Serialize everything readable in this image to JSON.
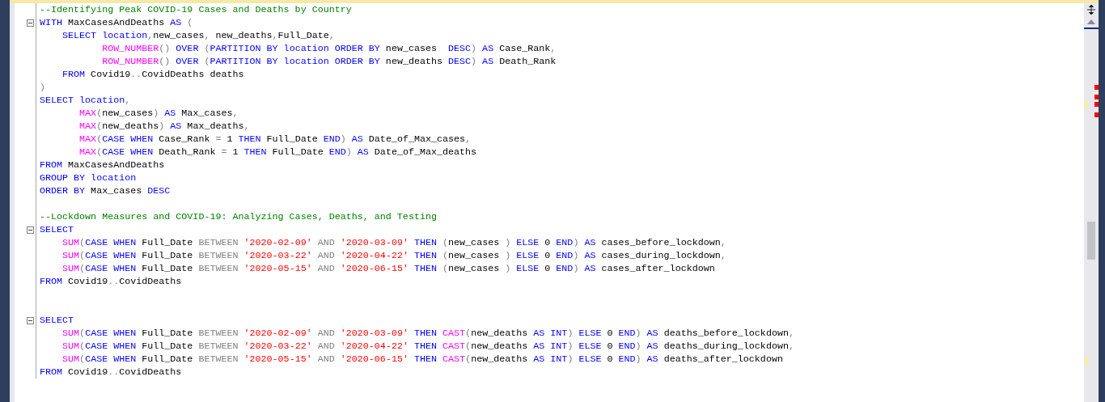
{
  "editor": {
    "lines": [
      {
        "kind": "code",
        "fold": false,
        "tokens": [
          {
            "text": "--Identifying Peak COVID-19 Cases and Deaths by Country",
            "kind": "comment"
          }
        ]
      },
      {
        "kind": "code",
        "fold": true,
        "tokens": [
          {
            "text": "WITH",
            "kind": "keyword"
          },
          {
            "text": " MaxCasesAndDeaths ",
            "kind": "plain"
          },
          {
            "text": "AS",
            "kind": "keyword"
          },
          {
            "text": " (",
            "kind": "punct"
          }
        ]
      },
      {
        "kind": "code",
        "fold": false,
        "tokens": [
          {
            "text": "    SELECT location",
            "kind": "keyword"
          },
          {
            "text": ",",
            "kind": "punct"
          },
          {
            "text": "new_cases",
            "kind": "plain"
          },
          {
            "text": ",",
            "kind": "punct"
          },
          {
            "text": " new_deaths",
            "kind": "plain"
          },
          {
            "text": ",",
            "kind": "punct"
          },
          {
            "text": "Full_Date",
            "kind": "plain"
          },
          {
            "text": ",",
            "kind": "punct"
          }
        ]
      },
      {
        "kind": "code",
        "fold": false,
        "tokens": [
          {
            "text": "           ROW_NUMBER",
            "kind": "function"
          },
          {
            "text": "()",
            "kind": "punct"
          },
          {
            "text": " OVER ",
            "kind": "keyword"
          },
          {
            "text": "(",
            "kind": "punct"
          },
          {
            "text": "PARTITION BY location ORDER BY",
            "kind": "keyword"
          },
          {
            "text": " new_cases  ",
            "kind": "plain"
          },
          {
            "text": "DESC",
            "kind": "keyword"
          },
          {
            "text": ")",
            "kind": "punct"
          },
          {
            "text": " AS",
            "kind": "keyword"
          },
          {
            "text": " Case_Rank",
            "kind": "plain"
          },
          {
            "text": ",",
            "kind": "punct"
          }
        ]
      },
      {
        "kind": "code",
        "fold": false,
        "tokens": [
          {
            "text": "           ROW_NUMBER",
            "kind": "function"
          },
          {
            "text": "()",
            "kind": "punct"
          },
          {
            "text": " OVER ",
            "kind": "keyword"
          },
          {
            "text": "(",
            "kind": "punct"
          },
          {
            "text": "PARTITION BY location ORDER BY",
            "kind": "keyword"
          },
          {
            "text": " new_deaths ",
            "kind": "plain"
          },
          {
            "text": "DESC",
            "kind": "keyword"
          },
          {
            "text": ")",
            "kind": "punct"
          },
          {
            "text": " AS",
            "kind": "keyword"
          },
          {
            "text": " Death_Rank",
            "kind": "plain"
          }
        ]
      },
      {
        "kind": "code",
        "fold": false,
        "tokens": [
          {
            "text": "    FROM",
            "kind": "keyword"
          },
          {
            "text": " Covid19",
            "kind": "plain"
          },
          {
            "text": "..",
            "kind": "punct"
          },
          {
            "text": "CovidDeaths deaths",
            "kind": "plain"
          }
        ]
      },
      {
        "kind": "code",
        "fold": false,
        "tokens": [
          {
            "text": ")",
            "kind": "punct"
          }
        ]
      },
      {
        "kind": "code",
        "fold": false,
        "tokens": [
          {
            "text": "SELECT location",
            "kind": "keyword"
          },
          {
            "text": ",",
            "kind": "punct"
          }
        ]
      },
      {
        "kind": "code",
        "fold": false,
        "tokens": [
          {
            "text": "       MAX",
            "kind": "function"
          },
          {
            "text": "(",
            "kind": "punct"
          },
          {
            "text": "new_cases",
            "kind": "plain"
          },
          {
            "text": ")",
            "kind": "punct"
          },
          {
            "text": " AS",
            "kind": "keyword"
          },
          {
            "text": " Max_cases",
            "kind": "plain"
          },
          {
            "text": ",",
            "kind": "punct"
          }
        ]
      },
      {
        "kind": "code",
        "fold": false,
        "tokens": [
          {
            "text": "       MAX",
            "kind": "function"
          },
          {
            "text": "(",
            "kind": "punct"
          },
          {
            "text": "new_deaths",
            "kind": "plain"
          },
          {
            "text": ")",
            "kind": "punct"
          },
          {
            "text": " AS",
            "kind": "keyword"
          },
          {
            "text": " Max_deaths",
            "kind": "plain"
          },
          {
            "text": ",",
            "kind": "punct"
          }
        ]
      },
      {
        "kind": "code",
        "fold": false,
        "tokens": [
          {
            "text": "       MAX",
            "kind": "function"
          },
          {
            "text": "(",
            "kind": "punct"
          },
          {
            "text": "CASE WHEN",
            "kind": "keyword"
          },
          {
            "text": " Case_Rank ",
            "kind": "plain"
          },
          {
            "text": "=",
            "kind": "punct"
          },
          {
            "text": " 1 ",
            "kind": "plain"
          },
          {
            "text": "THEN",
            "kind": "keyword"
          },
          {
            "text": " Full_Date ",
            "kind": "plain"
          },
          {
            "text": "END",
            "kind": "keyword"
          },
          {
            "text": ")",
            "kind": "punct"
          },
          {
            "text": " AS",
            "kind": "keyword"
          },
          {
            "text": " Date_of_Max_cases",
            "kind": "plain"
          },
          {
            "text": ",",
            "kind": "punct"
          }
        ]
      },
      {
        "kind": "code",
        "fold": false,
        "tokens": [
          {
            "text": "       MAX",
            "kind": "function"
          },
          {
            "text": "(",
            "kind": "punct"
          },
          {
            "text": "CASE WHEN",
            "kind": "keyword"
          },
          {
            "text": " Death_Rank ",
            "kind": "plain"
          },
          {
            "text": "=",
            "kind": "punct"
          },
          {
            "text": " 1 ",
            "kind": "plain"
          },
          {
            "text": "THEN",
            "kind": "keyword"
          },
          {
            "text": " Full_Date ",
            "kind": "plain"
          },
          {
            "text": "END",
            "kind": "keyword"
          },
          {
            "text": ")",
            "kind": "punct"
          },
          {
            "text": " AS",
            "kind": "keyword"
          },
          {
            "text": " Date_of_Max_deaths",
            "kind": "plain"
          }
        ]
      },
      {
        "kind": "code",
        "fold": false,
        "tokens": [
          {
            "text": "FROM",
            "kind": "keyword"
          },
          {
            "text": " MaxCasesAndDeaths",
            "kind": "plain"
          }
        ]
      },
      {
        "kind": "code",
        "fold": false,
        "tokens": [
          {
            "text": "GROUP BY location",
            "kind": "keyword"
          }
        ]
      },
      {
        "kind": "code",
        "fold": false,
        "tokens": [
          {
            "text": "ORDER BY",
            "kind": "keyword"
          },
          {
            "text": " Max_cases ",
            "kind": "plain"
          },
          {
            "text": "DESC",
            "kind": "keyword"
          }
        ]
      },
      {
        "kind": "blank"
      },
      {
        "kind": "code",
        "fold": false,
        "tokens": [
          {
            "text": "--Lockdown Measures and COVID-19: Analyzing Cases, Deaths, and Testing",
            "kind": "comment"
          }
        ]
      },
      {
        "kind": "code",
        "fold": true,
        "tokens": [
          {
            "text": "SELECT",
            "kind": "keyword"
          }
        ]
      },
      {
        "kind": "code",
        "fold": false,
        "tokens": [
          {
            "text": "    SUM",
            "kind": "function"
          },
          {
            "text": "(",
            "kind": "punct"
          },
          {
            "text": "CASE WHEN",
            "kind": "keyword"
          },
          {
            "text": " Full_Date ",
            "kind": "plain"
          },
          {
            "text": "BETWEEN",
            "kind": "punct"
          },
          {
            "text": " '2020-02-09' ",
            "kind": "string"
          },
          {
            "text": "AND",
            "kind": "punct"
          },
          {
            "text": " '2020-03-09' ",
            "kind": "string"
          },
          {
            "text": "THEN",
            "kind": "keyword"
          },
          {
            "text": " (",
            "kind": "punct"
          },
          {
            "text": "new_cases ",
            "kind": "plain"
          },
          {
            "text": ")",
            "kind": "punct"
          },
          {
            "text": " ELSE",
            "kind": "keyword"
          },
          {
            "text": " 0 ",
            "kind": "plain"
          },
          {
            "text": "END",
            "kind": "keyword"
          },
          {
            "text": ")",
            "kind": "punct"
          },
          {
            "text": " AS",
            "kind": "keyword"
          },
          {
            "text": " cases_before_lockdown",
            "kind": "plain"
          },
          {
            "text": ",",
            "kind": "punct"
          }
        ]
      },
      {
        "kind": "code",
        "fold": false,
        "tokens": [
          {
            "text": "    SUM",
            "kind": "function"
          },
          {
            "text": "(",
            "kind": "punct"
          },
          {
            "text": "CASE WHEN",
            "kind": "keyword"
          },
          {
            "text": " Full_Date ",
            "kind": "plain"
          },
          {
            "text": "BETWEEN",
            "kind": "punct"
          },
          {
            "text": " '2020-03-22' ",
            "kind": "string"
          },
          {
            "text": "AND",
            "kind": "punct"
          },
          {
            "text": " '2020-04-22' ",
            "kind": "string"
          },
          {
            "text": "THEN",
            "kind": "keyword"
          },
          {
            "text": " (",
            "kind": "punct"
          },
          {
            "text": "new_cases ",
            "kind": "plain"
          },
          {
            "text": ")",
            "kind": "punct"
          },
          {
            "text": " ELSE",
            "kind": "keyword"
          },
          {
            "text": " 0 ",
            "kind": "plain"
          },
          {
            "text": "END",
            "kind": "keyword"
          },
          {
            "text": ")",
            "kind": "punct"
          },
          {
            "text": " AS",
            "kind": "keyword"
          },
          {
            "text": " cases_during_lockdown",
            "kind": "plain"
          },
          {
            "text": ",",
            "kind": "punct"
          }
        ]
      },
      {
        "kind": "code",
        "fold": false,
        "tokens": [
          {
            "text": "    SUM",
            "kind": "function"
          },
          {
            "text": "(",
            "kind": "punct"
          },
          {
            "text": "CASE WHEN",
            "kind": "keyword"
          },
          {
            "text": " Full_Date ",
            "kind": "plain"
          },
          {
            "text": "BETWEEN",
            "kind": "punct"
          },
          {
            "text": " '2020-05-15' ",
            "kind": "string"
          },
          {
            "text": "AND",
            "kind": "punct"
          },
          {
            "text": " '2020-06-15' ",
            "kind": "string"
          },
          {
            "text": "THEN",
            "kind": "keyword"
          },
          {
            "text": " (",
            "kind": "punct"
          },
          {
            "text": "new_cases ",
            "kind": "plain"
          },
          {
            "text": ")",
            "kind": "punct"
          },
          {
            "text": " ELSE",
            "kind": "keyword"
          },
          {
            "text": " 0 ",
            "kind": "plain"
          },
          {
            "text": "END",
            "kind": "keyword"
          },
          {
            "text": ")",
            "kind": "punct"
          },
          {
            "text": " AS",
            "kind": "keyword"
          },
          {
            "text": " cases_after_lockdown",
            "kind": "plain"
          }
        ]
      },
      {
        "kind": "code",
        "fold": false,
        "tokens": [
          {
            "text": "FROM",
            "kind": "keyword"
          },
          {
            "text": " Covid19",
            "kind": "plain"
          },
          {
            "text": "..",
            "kind": "punct"
          },
          {
            "text": "CovidDeaths",
            "kind": "plain"
          }
        ]
      },
      {
        "kind": "blank"
      },
      {
        "kind": "blank"
      },
      {
        "kind": "code",
        "fold": true,
        "tokens": [
          {
            "text": "SELECT",
            "kind": "keyword"
          }
        ]
      },
      {
        "kind": "code",
        "fold": false,
        "tokens": [
          {
            "text": "    SUM",
            "kind": "function"
          },
          {
            "text": "(",
            "kind": "punct"
          },
          {
            "text": "CASE WHEN",
            "kind": "keyword"
          },
          {
            "text": " Full_Date ",
            "kind": "plain"
          },
          {
            "text": "BETWEEN",
            "kind": "punct"
          },
          {
            "text": " '2020-02-09' ",
            "kind": "string"
          },
          {
            "text": "AND",
            "kind": "punct"
          },
          {
            "text": " '2020-03-09' ",
            "kind": "string"
          },
          {
            "text": "THEN",
            "kind": "keyword"
          },
          {
            "text": " CAST",
            "kind": "function"
          },
          {
            "text": "(",
            "kind": "punct"
          },
          {
            "text": "new_deaths ",
            "kind": "plain"
          },
          {
            "text": "AS INT",
            "kind": "keyword"
          },
          {
            "text": ")",
            "kind": "punct"
          },
          {
            "text": " ELSE",
            "kind": "keyword"
          },
          {
            "text": " 0 ",
            "kind": "plain"
          },
          {
            "text": "END",
            "kind": "keyword"
          },
          {
            "text": ")",
            "kind": "punct"
          },
          {
            "text": " AS",
            "kind": "keyword"
          },
          {
            "text": " deaths_before_lockdown",
            "kind": "plain"
          },
          {
            "text": ",",
            "kind": "punct"
          }
        ]
      },
      {
        "kind": "code",
        "fold": false,
        "tokens": [
          {
            "text": "    SUM",
            "kind": "function"
          },
          {
            "text": "(",
            "kind": "punct"
          },
          {
            "text": "CASE WHEN",
            "kind": "keyword"
          },
          {
            "text": " Full_Date ",
            "kind": "plain"
          },
          {
            "text": "BETWEEN",
            "kind": "punct"
          },
          {
            "text": " '2020-03-22' ",
            "kind": "string"
          },
          {
            "text": "AND",
            "kind": "punct"
          },
          {
            "text": " '2020-04-22' ",
            "kind": "string"
          },
          {
            "text": "THEN",
            "kind": "keyword"
          },
          {
            "text": " CAST",
            "kind": "function"
          },
          {
            "text": "(",
            "kind": "punct"
          },
          {
            "text": "new_deaths ",
            "kind": "plain"
          },
          {
            "text": "AS INT",
            "kind": "keyword"
          },
          {
            "text": ")",
            "kind": "punct"
          },
          {
            "text": " ELSE",
            "kind": "keyword"
          },
          {
            "text": " 0 ",
            "kind": "plain"
          },
          {
            "text": "END",
            "kind": "keyword"
          },
          {
            "text": ")",
            "kind": "punct"
          },
          {
            "text": " AS",
            "kind": "keyword"
          },
          {
            "text": " deaths_during_lockdown",
            "kind": "plain"
          },
          {
            "text": ",",
            "kind": "punct"
          }
        ]
      },
      {
        "kind": "code",
        "fold": false,
        "tokens": [
          {
            "text": "    SUM",
            "kind": "function"
          },
          {
            "text": "(",
            "kind": "punct"
          },
          {
            "text": "CASE WHEN",
            "kind": "keyword"
          },
          {
            "text": " Full_Date ",
            "kind": "plain"
          },
          {
            "text": "BETWEEN",
            "kind": "punct"
          },
          {
            "text": " '2020-05-15' ",
            "kind": "string"
          },
          {
            "text": "AND",
            "kind": "punct"
          },
          {
            "text": " '2020-06-15' ",
            "kind": "string"
          },
          {
            "text": "THEN",
            "kind": "keyword"
          },
          {
            "text": " CAST",
            "kind": "function"
          },
          {
            "text": "(",
            "kind": "punct"
          },
          {
            "text": "new_deaths ",
            "kind": "plain"
          },
          {
            "text": "AS INT",
            "kind": "keyword"
          },
          {
            "text": ")",
            "kind": "punct"
          },
          {
            "text": " ELSE",
            "kind": "keyword"
          },
          {
            "text": " 0 ",
            "kind": "plain"
          },
          {
            "text": "END",
            "kind": "keyword"
          },
          {
            "text": ")",
            "kind": "punct"
          },
          {
            "text": " AS",
            "kind": "keyword"
          },
          {
            "text": " deaths_after_lockdown",
            "kind": "plain"
          }
        ]
      },
      {
        "kind": "code",
        "fold": false,
        "tokens": [
          {
            "text": "FROM",
            "kind": "keyword"
          },
          {
            "text": " Covid19",
            "kind": "plain"
          },
          {
            "text": "..",
            "kind": "punct"
          },
          {
            "text": "CovidDeaths",
            "kind": "plain"
          }
        ]
      }
    ]
  }
}
